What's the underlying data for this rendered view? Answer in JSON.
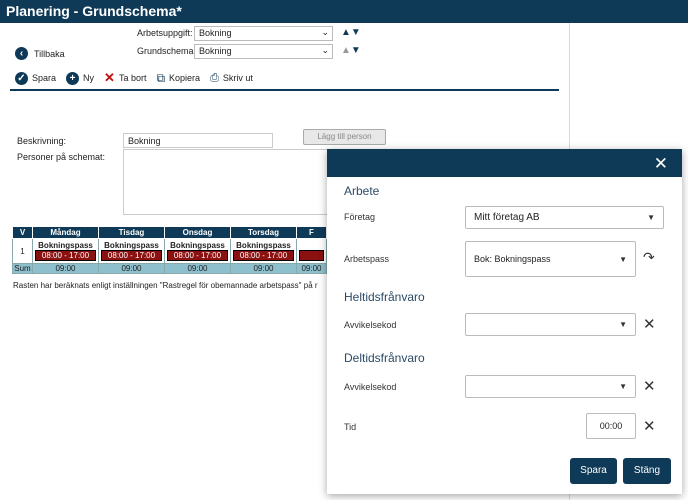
{
  "window": {
    "title": "Planering - Grundschema*"
  },
  "back": {
    "label": "Tillbaka"
  },
  "filters": {
    "task_label": "Arbetsuppgift:",
    "task_value": "Bokning",
    "schema_label": "Grundschema:",
    "schema_value": "Bokning"
  },
  "toolbar": {
    "save": "Spara",
    "new": "Ny",
    "delete": "Ta bort",
    "copy": "Kopiera",
    "print": "Skriv ut"
  },
  "form": {
    "description_label": "Beskrivning:",
    "description_value": "Bokning",
    "persons_label": "Personer på schemat:",
    "add_person": "Lägg till person"
  },
  "schedule": {
    "headers": [
      "V",
      "Måndag",
      "Tisdag",
      "Onsdag",
      "Torsdag",
      "F"
    ],
    "week": "1",
    "pass_name": "Bokningspass",
    "pass_time": "08:00 - 17:00",
    "sum_label": "Sum",
    "sum_value": "09:00"
  },
  "note": "Rasten har beräknats enligt inställningen \"Rastregel för obemannade arbetspass\" på r",
  "modal": {
    "section_work": "Arbete",
    "company_label": "Företag",
    "company_value": "Mitt företag AB",
    "shift_label": "Arbetspass",
    "shift_value": "Bok: Bokningspass",
    "section_fulltime": "Heltidsfrånvaro",
    "deviation_label_1": "Avvikelsekod",
    "section_parttime": "Deltidsfrånvaro",
    "deviation_label_2": "Avvikelsekod",
    "time_label": "Tid",
    "time_value": "00:00",
    "save": "Spara",
    "close": "Stäng"
  },
  "colors": {
    "brand": "#0f3a57",
    "pass_time_bg": "#8b1010",
    "sum_row": "#8ebfcc"
  }
}
